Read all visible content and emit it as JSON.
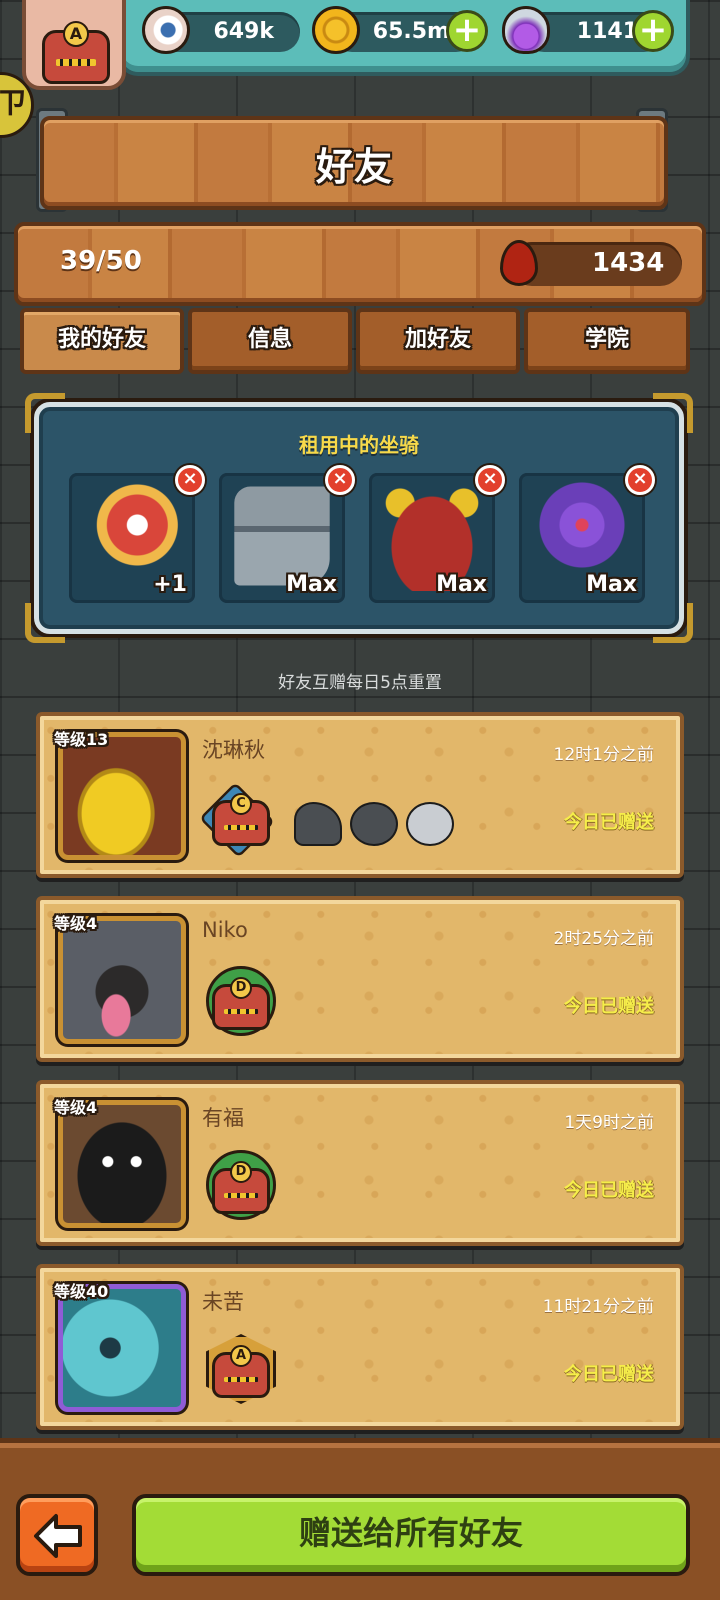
{
  "resources": {
    "eyes": "649k",
    "coins": "65.5m",
    "potions": "1141"
  },
  "player": {
    "rank": "A"
  },
  "title": "好友",
  "stats": {
    "friends": "39/50",
    "blood": "1434"
  },
  "tabs": [
    {
      "label": "我的好友",
      "active": true
    },
    {
      "label": "信息",
      "active": false
    },
    {
      "label": "加好友",
      "active": false
    },
    {
      "label": "学院",
      "active": false
    }
  ],
  "rental": {
    "title": "租用中的坐骑",
    "mounts": [
      {
        "level": "+1",
        "name": "lion-dance-mount",
        "color": "#d9463a"
      },
      {
        "level": "Max",
        "name": "mecha-cannon-mount",
        "color": "#8e9aa2"
      },
      {
        "level": "Max",
        "name": "red-demon-mount",
        "color": "#b2302a"
      },
      {
        "level": "Max",
        "name": "purple-rose-mount",
        "color": "#6a3fb8"
      }
    ]
  },
  "reset_note": "好友互赠每日5点重置",
  "friends": [
    {
      "level": "等级13",
      "name": "沈琳秋",
      "time": "12时1分之前",
      "status": "今日已赠送",
      "rank": "C",
      "avatar": "beehive",
      "pets": 3
    },
    {
      "level": "等级4",
      "name": "Niko",
      "time": "2时25分之前",
      "status": "今日已赠送",
      "rank": "D",
      "avatar": "rock-golem",
      "pets": 0
    },
    {
      "level": "等级4",
      "name": "有福",
      "time": "1天9时之前",
      "status": "今日已赠送",
      "rank": "D",
      "avatar": "shadow",
      "pets": 0
    },
    {
      "level": "等级40",
      "name": "未苦",
      "time": "11时21分之前",
      "status": "今日已赠送",
      "rank": "A",
      "avatar": "blue-slime",
      "pets": 0
    }
  ],
  "bottom": {
    "send_all": "赠送给所有好友"
  }
}
